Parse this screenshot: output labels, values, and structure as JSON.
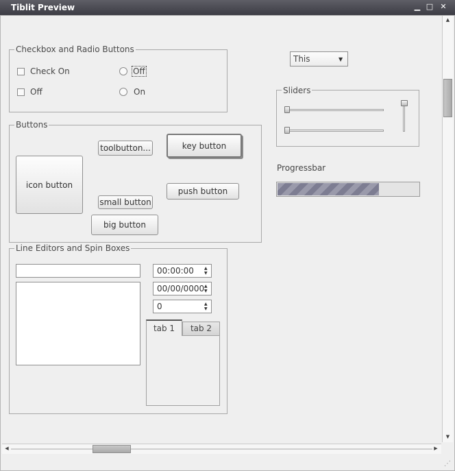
{
  "window": {
    "title": "Tiblit Preview"
  },
  "checkbox_group": {
    "title": "Checkbox and Radio Buttons",
    "checkboxes": [
      {
        "label": "Check On",
        "checked": false
      },
      {
        "label": "Off",
        "checked": false
      }
    ],
    "radios": [
      {
        "label": "Off",
        "checked": false
      },
      {
        "label": "On",
        "checked": false
      }
    ]
  },
  "combo": {
    "value": "This"
  },
  "sliders": {
    "title": "Sliders"
  },
  "progress": {
    "title": "Progressbar",
    "value_percent": 72
  },
  "buttons": {
    "title": "Buttons",
    "icon_button": "icon button",
    "toolbutton": "toolbutton...",
    "key_button": "key button",
    "push_button": "push button",
    "small_button": "small button",
    "big_button": "big button"
  },
  "editors": {
    "title": "Line Editors and Spin Boxes",
    "time_value": "00:00:00",
    "date_value": "00/00/0000",
    "number_value": "0",
    "tabs": [
      {
        "label": "tab 1"
      },
      {
        "label": "tab 2"
      }
    ]
  }
}
